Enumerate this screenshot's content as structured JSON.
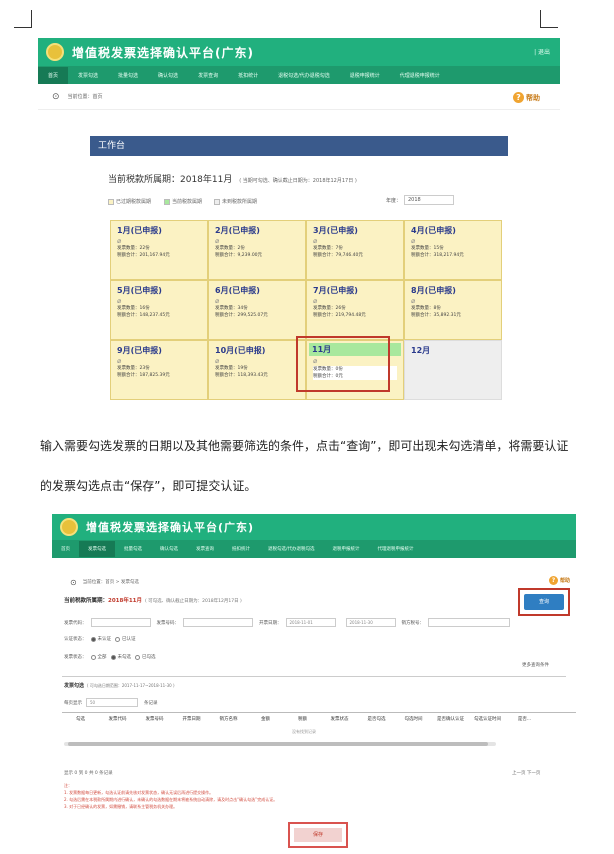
{
  "app": {
    "title": "增值税发票选择确认平台(广东)",
    "header_right": "| 退出",
    "nav_items": [
      "首页",
      "发票勾选",
      "批量勾选",
      "确认勾选",
      "发票查询",
      "抵扣统计",
      "退税勾选/代办退税勾选",
      "退税申报统计",
      "代理退税申报统计"
    ],
    "active_nav": 0,
    "breadcrumb": "当前位置：首页",
    "help_label": "帮助"
  },
  "workbench": {
    "header": "工作台",
    "period_label": "当前税款所属期：2018年11月",
    "period_note": "( 当期可勾选、确认截止日期为：2018年12月17日 )",
    "legend": [
      "已过期税款属期",
      "当前税款属期",
      "未到税款所属期"
    ],
    "year_label": "年度：",
    "year_value": "2018",
    "months": [
      {
        "name": "1月(已申报)",
        "count": "发票数量：22份",
        "amount": "税额合计：201,167.94元"
      },
      {
        "name": "2月(已申报)",
        "count": "发票数量：2份",
        "amount": "税额合计：9,239.00元"
      },
      {
        "name": "3月(已申报)",
        "count": "发票数量：7份",
        "amount": "税额合计：79,746.40元"
      },
      {
        "name": "4月(已申报)",
        "count": "发票数量：15份",
        "amount": "税额合计：318,217.94元"
      },
      {
        "name": "5月(已申报)",
        "count": "发票数量：16份",
        "amount": "税额合计：148,237.45元"
      },
      {
        "name": "6月(已申报)",
        "count": "发票数量：34份",
        "amount": "税额合计：299,525.07元"
      },
      {
        "name": "7月(已申报)",
        "count": "发票数量：26份",
        "amount": "税额合计：219,794.48元"
      },
      {
        "name": "8月(已申报)",
        "count": "发票数量：8份",
        "amount": "税额合计：35,892.31元"
      },
      {
        "name": "9月(已申报)",
        "count": "发票数量：23份",
        "amount": "税额合计：187,825.39元"
      },
      {
        "name": "10月(已申报)",
        "count": "发票数量：19份",
        "amount": "税额合计：118,393.43元"
      },
      {
        "name": "11月",
        "count": "发票数量：0份",
        "amount": "税额合计：0元"
      },
      {
        "name": "12月",
        "count": "",
        "amount": ""
      }
    ]
  },
  "paragraph": "输入需要勾选发票的日期以及其他需要筛选的条件，点击“查询”，即可出现未勾选清单，将需要认证的发票勾选点击“保存”，即可提交认证。",
  "query_page": {
    "breadcrumb": "当前位置：首页 > 发票勾选",
    "period_label": "当前税款所属期：",
    "period_value": "2018年11月",
    "period_note": "( 可勾选、确认截止日期为：2018年12月17日 )",
    "query_button": "查询",
    "fields": {
      "invoice_code": "发票代码：",
      "invoice_number": "发票号码：",
      "issue_date": "开票日期：",
      "date_from": "2018-11-01",
      "date_to": "2018-11-30",
      "seller_tax_id": "销方税号："
    },
    "auth_status_label": "认证状态：",
    "auth_options": [
      "未认证",
      "已认证"
    ],
    "invoice_status_label": "发票状态：",
    "status_options": [
      "全部",
      "未勾选",
      "已勾选"
    ],
    "more_options": "更多查询条件",
    "section_title": "发票勾选",
    "section_note": "( 可勾选日期范围：2017-11-17~2018-11-30 )",
    "page_size_label": "每页显示",
    "page_size": "50",
    "page_size_suffix": "条记录",
    "columns": [
      "勾选",
      "发票代码",
      "发票号码",
      "开票日期",
      "销方名称",
      "金额",
      "税额",
      "发票状态",
      "是否勾选",
      "勾选时间",
      "是否确认认证",
      "勾选认证时间",
      "是否..."
    ],
    "no_data": "没有找到记录",
    "footer_info": "显示 0 到 0 共 0 条记录",
    "pager": "上一页  下一页",
    "notes": [
      "注：",
      "1. 发票数据每日更新，勾选认证前请先核对发票状态，确认无误后再进行提交操作。",
      "2. 勾选后需在本税款所属期内进行确认，未确认的勾选数据在期末将被系统自动清除，请及时点击“确认勾选”完成认证。",
      "3. 对于已经确认的发票，如需撤销，请联系主管税务机关办理。"
    ],
    "save_button": "保存"
  },
  "colors": {
    "banner": "#21b07e",
    "nav": "#1e9a6d",
    "workbench_header": "#3a5a8c",
    "month_cell": "#fbf2c3",
    "current_month": "#a8e89d",
    "highlight": "#c0392b",
    "query_button": "#2f7ec2"
  }
}
